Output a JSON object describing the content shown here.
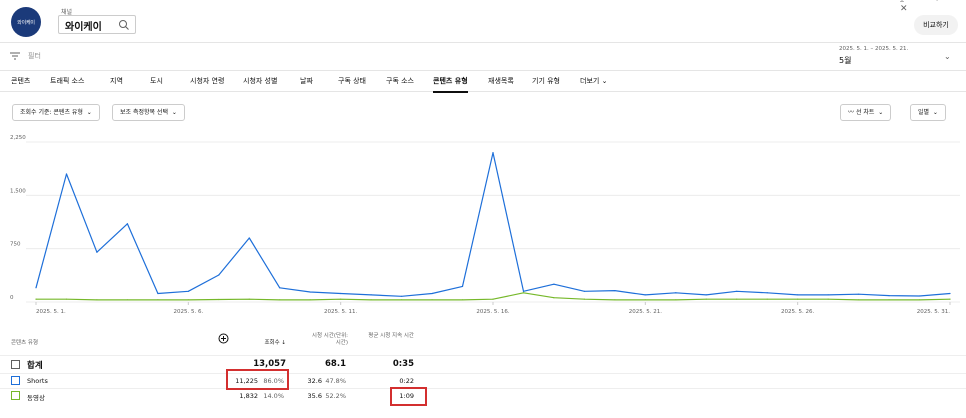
{
  "header": {
    "avatar_text": "와이케이",
    "channel_label": "채널",
    "channel_name": "와이케이",
    "compare_label": "비교하기",
    "top_icons": "⤓ ⚑ ✕"
  },
  "filter": {
    "label": "필터",
    "date_range": "2025. 5. 1. – 2025. 5. 21.",
    "date_period": "5월"
  },
  "tabs": [
    "콘텐츠",
    "트래픽 소스",
    "지역",
    "도시",
    "시청자 연령",
    "시청자 성별",
    "날짜",
    "구독 상태",
    "구독 소스",
    "콘텐츠 유형",
    "재생목록",
    "기기 유형",
    "더보기"
  ],
  "active_tab": "콘텐츠 유형",
  "chips": {
    "breakdown": "조회수 기준: 콘텐츠 유형",
    "secondary": "보조 측정항목 선택",
    "chart_type": "선 차트",
    "interval": "일별"
  },
  "chart_data": {
    "type": "line",
    "ylim": [
      0,
      2250
    ],
    "y_ticks": [
      "2,250",
      "1,500",
      "750",
      "0"
    ],
    "x_tick_labels": [
      "2025. 5. 1.",
      "2025. 5. 6.",
      "2025. 5. 11.",
      "2025. 5. 16.",
      "2025. 5. 21.",
      "2025. 5. 26.",
      "2025. 5. 31."
    ],
    "x": [
      "5/1",
      "5/2",
      "5/3",
      "5/4",
      "5/5",
      "5/6",
      "5/7",
      "5/8",
      "5/9",
      "5/10",
      "5/11",
      "5/12",
      "5/13",
      "5/14",
      "5/15",
      "5/16",
      "5/17",
      "5/18",
      "5/19",
      "5/20",
      "5/21",
      "5/22",
      "5/23",
      "5/24",
      "5/25",
      "5/26",
      "5/27",
      "5/28",
      "5/29",
      "5/30",
      "5/31"
    ],
    "series": [
      {
        "name": "Shorts",
        "color": "#1e6fd9",
        "values": [
          200,
          1800,
          700,
          1100,
          120,
          150,
          380,
          900,
          200,
          140,
          120,
          100,
          80,
          120,
          220,
          2100,
          150,
          250,
          150,
          160,
          100,
          130,
          100,
          150,
          130,
          100,
          100,
          110,
          90,
          85,
          120
        ]
      },
      {
        "name": "동영상",
        "color": "#76b82a",
        "values": [
          40,
          40,
          30,
          30,
          30,
          30,
          35,
          40,
          30,
          30,
          40,
          30,
          30,
          30,
          30,
          40,
          130,
          60,
          40,
          30,
          30,
          30,
          40,
          40,
          40,
          40,
          40,
          30,
          30,
          30,
          40
        ]
      }
    ]
  },
  "table": {
    "headers": {
      "type": "콘텐츠 유형",
      "views": "조회수 ↓",
      "watch_time": "시청 시간(단위: 시간)",
      "avg_duration": "평균 시청 지속 시간"
    },
    "total": {
      "label": "합계",
      "views": "13,057",
      "watch_time": "68.1",
      "avg_duration": "0:35"
    },
    "rows": [
      {
        "label": "Shorts",
        "color": "#1e6fd9",
        "views": "11,225",
        "views_pct": "86.0%",
        "watch_time": "32.6",
        "watch_pct": "47.8%",
        "avg_duration": "0:22"
      },
      {
        "label": "동영상",
        "color": "#76b82a",
        "views": "1,832",
        "views_pct": "14.0%",
        "watch_time": "35.6",
        "watch_pct": "52.2%",
        "avg_duration": "1:09"
      }
    ]
  }
}
